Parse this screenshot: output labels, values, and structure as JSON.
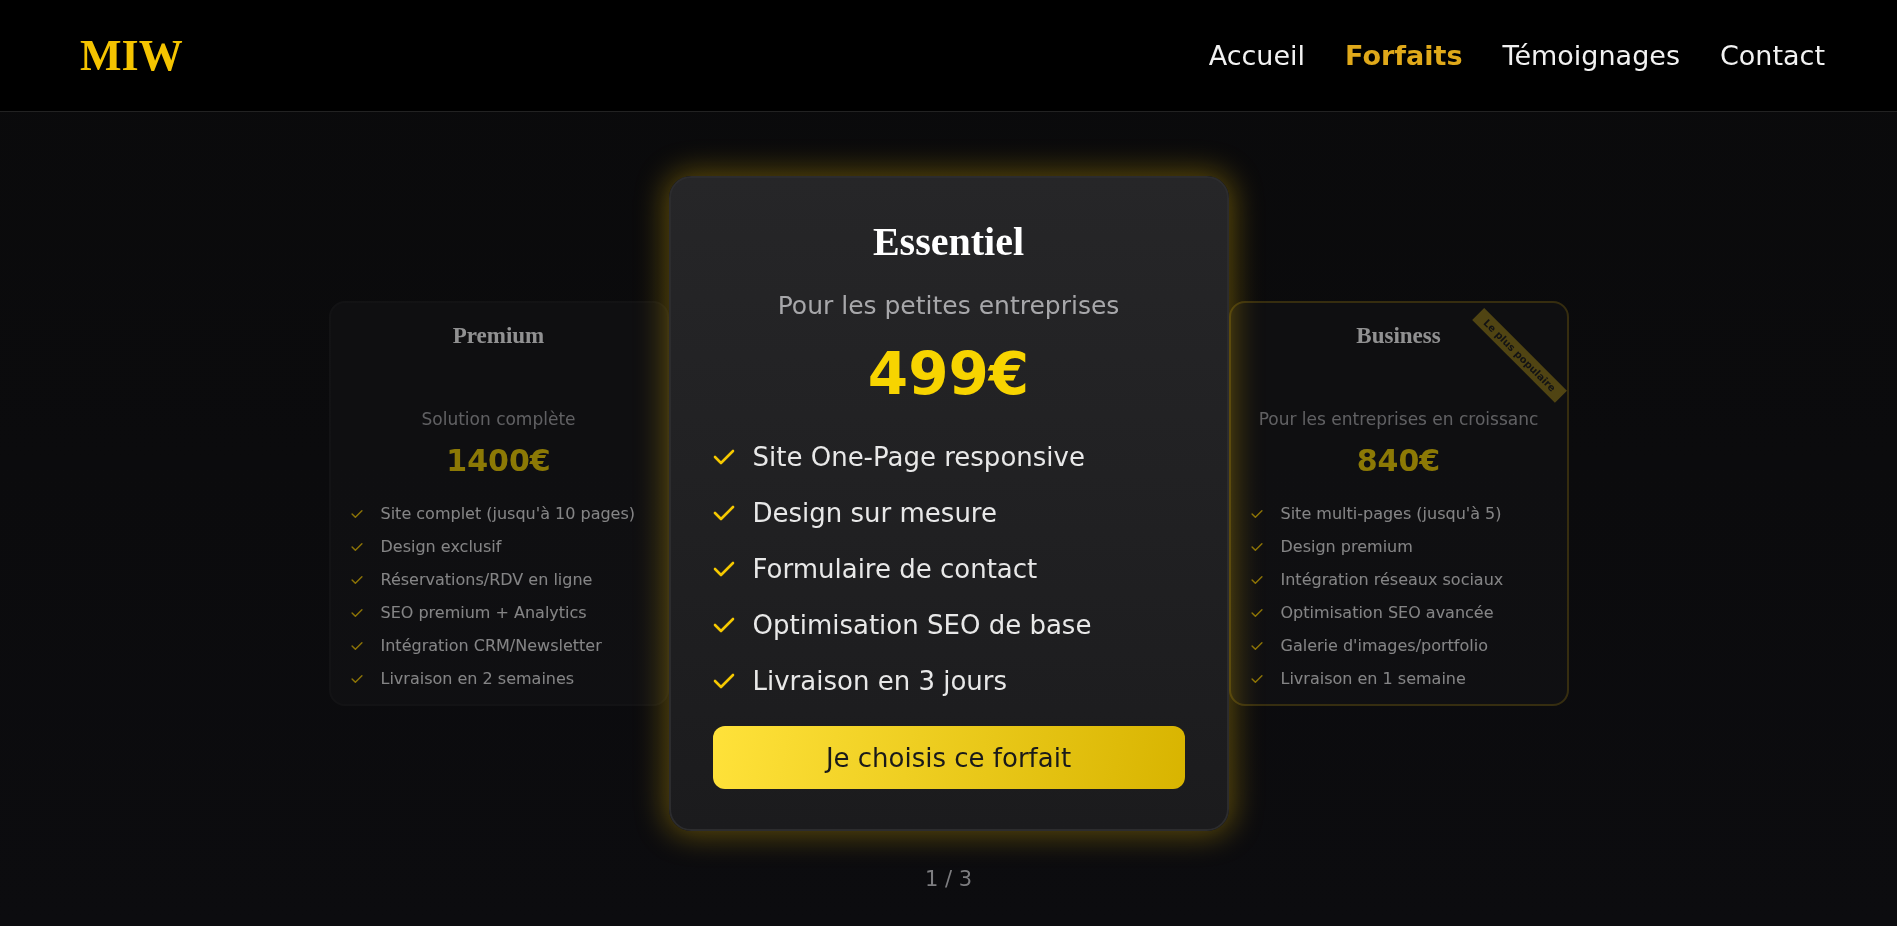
{
  "logo": "MIW",
  "nav": [
    {
      "label": "Accueil",
      "selected": false
    },
    {
      "label": "Forfaits",
      "selected": true
    },
    {
      "label": "Témoignages",
      "selected": false
    },
    {
      "label": "Contact",
      "selected": false
    }
  ],
  "plans": [
    {
      "name": "Premium",
      "subtitle": "Solution complète",
      "price": "1400€",
      "selected": false,
      "highlighted": false,
      "features": [
        "Site complet (jusqu'à 10 pages)",
        "Design exclusif",
        "Réservations/RDV en ligne",
        "SEO premium + Analytics",
        "Intégration CRM/Newsletter",
        "Livraison en 2 semaines"
      ]
    },
    {
      "name": "Essentiel",
      "subtitle": "Pour les petites entreprises",
      "price": "499€",
      "selected": true,
      "highlighted": false,
      "features": [
        "Site One-Page responsive",
        "Design sur mesure",
        "Formulaire de contact",
        "Optimisation SEO de base",
        "Livraison en 3 jours"
      ],
      "button": "Je choisis ce forfait"
    },
    {
      "name": "Business",
      "subtitle": "Pour les entreprises en croissanc",
      "price": "840€",
      "selected": false,
      "highlighted": true,
      "badge": "Le plus populaire",
      "features": [
        "Site multi-pages (jusqu'à 5)",
        "Design premium",
        "Intégration réseaux sociaux",
        "Optimisation SEO avancée",
        "Galerie d'images/portfolio",
        "Livraison en 1 semaine"
      ]
    }
  ],
  "pager": "1 / 3"
}
